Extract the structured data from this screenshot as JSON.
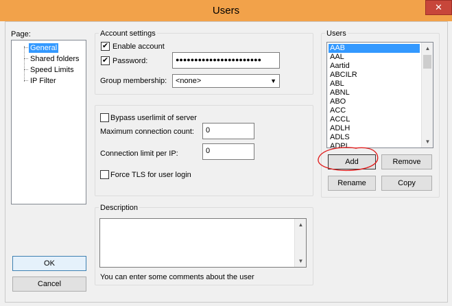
{
  "window": {
    "title": "Users",
    "close_label": "✕"
  },
  "page_label": "Page:",
  "page_tree": [
    {
      "label": "General",
      "selected": true
    },
    {
      "label": "Shared folders",
      "selected": false
    },
    {
      "label": "Speed Limits",
      "selected": false
    },
    {
      "label": "IP Filter",
      "selected": false
    }
  ],
  "account": {
    "group_title": "Account settings",
    "enable_label": "Enable account",
    "enable_checked": "✔",
    "password_label": "Password:",
    "password_checked": "✔",
    "password_value": "●●●●●●●●●●●●●●●●●●●●●●●",
    "group_membership_label": "Group membership:",
    "group_membership_value": "<none>"
  },
  "limits": {
    "bypass_label": "Bypass userlimit of server",
    "max_conn_label": "Maximum connection count:",
    "max_conn_value": "0",
    "per_ip_label": "Connection limit per IP:",
    "per_ip_value": "0",
    "force_tls_label": "Force TLS for user login"
  },
  "description": {
    "group_title": "Description",
    "hint": "You can enter some comments about the user"
  },
  "users": {
    "group_title": "Users",
    "items": [
      "AAB",
      "AAL",
      "Aartid",
      "ABCILR",
      "ABL",
      "ABNL",
      "ABO",
      "ACC",
      "ACCL",
      "ADLH",
      "ADLS",
      "ADPI"
    ],
    "selected_index": 0
  },
  "buttons": {
    "add": "Add",
    "remove": "Remove",
    "rename": "Rename",
    "copy": "Copy",
    "ok": "OK",
    "cancel": "Cancel"
  },
  "colors": {
    "titlebar": "#f2a24a",
    "selection": "#3399ff",
    "annotation": "#e02020"
  }
}
